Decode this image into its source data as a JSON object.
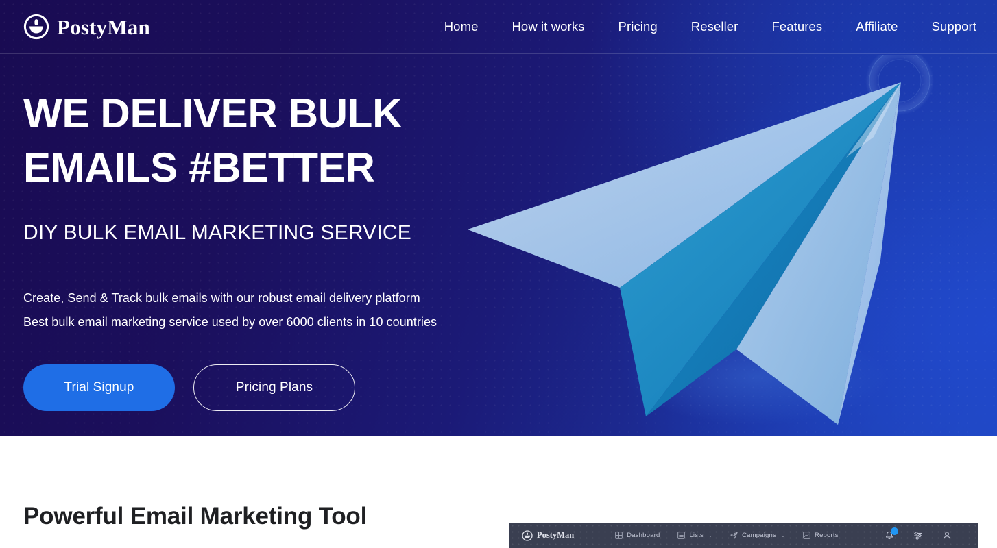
{
  "brand": {
    "name": "PostyMan",
    "logo_icon": "postman-cap-icon"
  },
  "nav": {
    "items": [
      {
        "label": "Home"
      },
      {
        "label": "How it works"
      },
      {
        "label": "Pricing"
      },
      {
        "label": "Reseller"
      },
      {
        "label": "Features"
      },
      {
        "label": "Affiliate"
      },
      {
        "label": "Support"
      }
    ]
  },
  "hero": {
    "title_line1": "WE DELIVER BULK",
    "title_line2": "EMAILS #BETTER",
    "subtitle": "DIY BULK EMAIL MARKETING SERVICE",
    "lead_line1": "Create, Send & Track bulk emails with our robust email delivery platform",
    "lead_line2": "Best bulk email marketing service used by over 6000 clients in 10 countries",
    "primary_button": "Trial Signup",
    "secondary_button": "Pricing Plans",
    "illustration": "paper-plane-illustration"
  },
  "lower": {
    "heading": "Powerful Email Marketing Tool"
  },
  "dashboard_preview": {
    "brand": "PostyMan",
    "nav": [
      {
        "label": "Dashboard",
        "icon": "grid-icon",
        "caret": ""
      },
      {
        "label": "Lists",
        "icon": "list-icon",
        "caret": "⌄"
      },
      {
        "label": "Campaigns",
        "icon": "paper-plane-icon",
        "caret": "⌄"
      },
      {
        "label": "Reports",
        "icon": "chart-icon",
        "caret": ""
      }
    ],
    "actions": [
      {
        "icon": "bell-icon",
        "badge": true
      },
      {
        "icon": "sliders-icon",
        "badge": false
      },
      {
        "icon": "user-icon",
        "badge": false
      }
    ]
  },
  "colors": {
    "hero_dark": "#190b52",
    "hero_bright": "#2048bd",
    "accent_blue": "#1f6ee6",
    "plane_light": "#a9c8ec",
    "plane_mid": "#7fb3e0",
    "plane_dark": "#1a86c4",
    "dashboard_bar": "#3a3f51",
    "badge": "#2196f3",
    "heading_dark": "#1f2023"
  }
}
